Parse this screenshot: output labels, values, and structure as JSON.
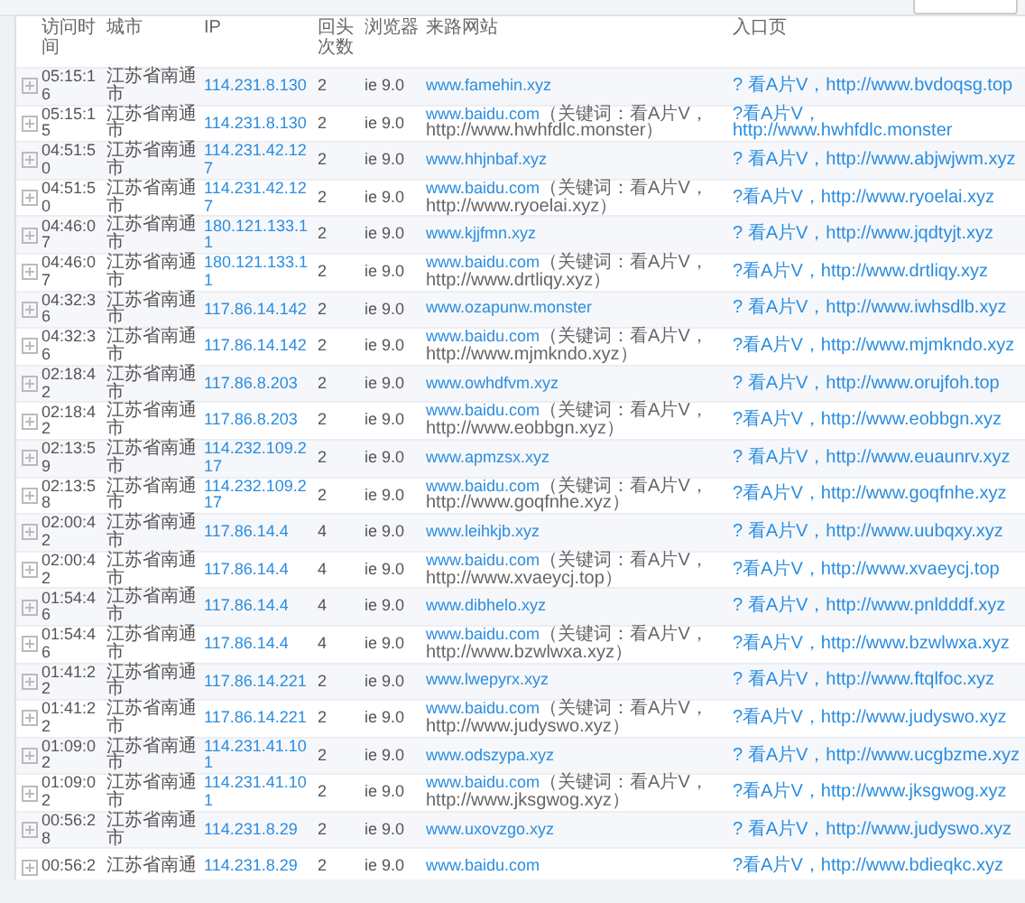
{
  "columns": [
    "访问时间",
    "城市",
    "IP",
    "回头次数",
    "浏览器",
    "来路网站",
    "入口页"
  ],
  "rows": [
    {
      "time": "05:15:16",
      "city": "江苏省南通市",
      "ip": "114.231.8.130",
      "visits": "2",
      "browser": "ie 9.0",
      "source": "www.famehin.xyz",
      "entry": "? 看A片V，http://www.bvdoqsg.top"
    },
    {
      "time": "05:15:15",
      "city": "江苏省南通市",
      "ip": "114.231.8.130",
      "visits": "2",
      "browser": "ie 9.0",
      "source": "www.baidu.com",
      "note": "（关键词：看A片V，http://www.hwhfdlc.monster）",
      "entry": "?看A片V，http://www.hwhfdlc.monster"
    },
    {
      "time": "04:51:50",
      "city": "江苏省南通市",
      "ip": "114.231.42.127",
      "visits": "2",
      "browser": "ie 9.0",
      "source": "www.hhjnbaf.xyz",
      "entry": "? 看A片V，http://www.abjwjwm.xyz"
    },
    {
      "time": "04:51:50",
      "city": "江苏省南通市",
      "ip": "114.231.42.127",
      "visits": "2",
      "browser": "ie 9.0",
      "source": "www.baidu.com",
      "note": "（关键词：看A片V，http://www.ryoelai.xyz）",
      "entry": "?看A片V，http://www.ryoelai.xyz"
    },
    {
      "time": "04:46:07",
      "city": "江苏省南通市",
      "ip": "180.121.133.11",
      "visits": "2",
      "browser": "ie 9.0",
      "source": "www.kjjfmn.xyz",
      "entry": "? 看A片V，http://www.jqdtyjt.xyz"
    },
    {
      "time": "04:46:07",
      "city": "江苏省南通市",
      "ip": "180.121.133.11",
      "visits": "2",
      "browser": "ie 9.0",
      "source": "www.baidu.com",
      "note": "（关键词：看A片V，http://www.drtliqy.xyz）",
      "entry": "?看A片V，http://www.drtliqy.xyz"
    },
    {
      "time": "04:32:36",
      "city": "江苏省南通市",
      "ip": "117.86.14.142",
      "visits": "2",
      "browser": "ie 9.0",
      "source": "www.ozapunw.monster",
      "entry": "? 看A片V，http://www.iwhsdlb.xyz"
    },
    {
      "time": "04:32:36",
      "city": "江苏省南通市",
      "ip": "117.86.14.142",
      "visits": "2",
      "browser": "ie 9.0",
      "source": "www.baidu.com",
      "note": "（关键词：看A片V，http://www.mjmkndo.xyz）",
      "entry": "?看A片V，http://www.mjmkndo.xyz"
    },
    {
      "time": "02:18:42",
      "city": "江苏省南通市",
      "ip": "117.86.8.203",
      "visits": "2",
      "browser": "ie 9.0",
      "source": "www.owhdfvm.xyz",
      "entry": "? 看A片V，http://www.orujfoh.top"
    },
    {
      "time": "02:18:42",
      "city": "江苏省南通市",
      "ip": "117.86.8.203",
      "visits": "2",
      "browser": "ie 9.0",
      "source": "www.baidu.com",
      "note": "（关键词：看A片V，http://www.eobbgn.xyz）",
      "entry": "?看A片V，http://www.eobbgn.xyz"
    },
    {
      "time": "02:13:59",
      "city": "江苏省南通市",
      "ip": "114.232.109.217",
      "visits": "2",
      "browser": "ie 9.0",
      "source": "www.apmzsx.xyz",
      "entry": "? 看A片V，http://www.euaunrv.xyz"
    },
    {
      "time": "02:13:58",
      "city": "江苏省南通市",
      "ip": "114.232.109.217",
      "visits": "2",
      "browser": "ie 9.0",
      "source": "www.baidu.com",
      "note": "（关键词：看A片V，http://www.goqfnhe.xyz）",
      "entry": "?看A片V，http://www.goqfnhe.xyz"
    },
    {
      "time": "02:00:42",
      "city": "江苏省南通市",
      "ip": "117.86.14.4",
      "visits": "4",
      "browser": "ie 9.0",
      "source": "www.leihkjb.xyz",
      "entry": "? 看A片V，http://www.uubqxy.xyz"
    },
    {
      "time": "02:00:42",
      "city": "江苏省南通市",
      "ip": "117.86.14.4",
      "visits": "4",
      "browser": "ie 9.0",
      "source": "www.baidu.com",
      "note": "（关键词：看A片V，http://www.xvaeycj.top）",
      "entry": "?看A片V，http://www.xvaeycj.top"
    },
    {
      "time": "01:54:46",
      "city": "江苏省南通市",
      "ip": "117.86.14.4",
      "visits": "4",
      "browser": "ie 9.0",
      "source": "www.dibhelo.xyz",
      "entry": "? 看A片V，http://www.pnldddf.xyz"
    },
    {
      "time": "01:54:46",
      "city": "江苏省南通市",
      "ip": "117.86.14.4",
      "visits": "4",
      "browser": "ie 9.0",
      "source": "www.baidu.com",
      "note": "（关键词：看A片V，http://www.bzwlwxa.xyz）",
      "entry": "?看A片V，http://www.bzwlwxa.xyz"
    },
    {
      "time": "01:41:22",
      "city": "江苏省南通市",
      "ip": "117.86.14.221",
      "visits": "2",
      "browser": "ie 9.0",
      "source": "www.lwepyrx.xyz",
      "entry": "? 看A片V，http://www.ftqlfoc.xyz"
    },
    {
      "time": "01:41:22",
      "city": "江苏省南通市",
      "ip": "117.86.14.221",
      "visits": "2",
      "browser": "ie 9.0",
      "source": "www.baidu.com",
      "note": "（关键词：看A片V，http://www.judyswo.xyz）",
      "entry": "?看A片V，http://www.judyswo.xyz"
    },
    {
      "time": "01:09:02",
      "city": "江苏省南通市",
      "ip": "114.231.41.101",
      "visits": "2",
      "browser": "ie 9.0",
      "source": "www.odszypa.xyz",
      "entry": "? 看A片V，http://www.ucgbzme.xyz"
    },
    {
      "time": "01:09:02",
      "city": "江苏省南通市",
      "ip": "114.231.41.101",
      "visits": "2",
      "browser": "ie 9.0",
      "source": "www.baidu.com",
      "note": "（关键词：看A片V，http://www.jksgwog.xyz）",
      "entry": "?看A片V，http://www.jksgwog.xyz"
    },
    {
      "time": "00:56:28",
      "city": "江苏省南通市",
      "ip": "114.231.8.29",
      "visits": "2",
      "browser": "ie 9.0",
      "source": "www.uxovzgo.xyz",
      "entry": "? 看A片V，http://www.judyswo.xyz"
    },
    {
      "time": "00:56:2",
      "city": "江苏省南通",
      "ip": "114.231.8.29",
      "visits": "2",
      "browser": "ie 9.0",
      "source": "www.baidu.com",
      "entry": "?看A片V，http://www.bdieqkc.xyz"
    }
  ]
}
